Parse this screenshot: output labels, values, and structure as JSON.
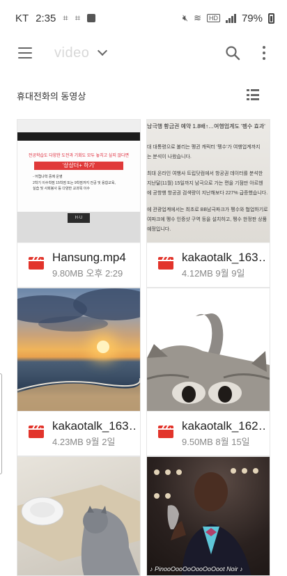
{
  "status_bar": {
    "carrier": "KT",
    "time": "2:35",
    "hd_badge": "HD",
    "battery_percent": "79%"
  },
  "toolbar": {
    "title": "video",
    "icons": [
      "menu-icon",
      "chevron-down-icon",
      "search-icon",
      "more-vert-icon"
    ]
  },
  "section": {
    "label": "휴대전화의 동영상",
    "view_toggle_icon": "list-view-icon"
  },
  "videos": [
    {
      "name": "Hansung.mp4",
      "meta": "9.80MB 오후 2:29",
      "slide": {
        "headline": "전공학습도 다양한 도전과 기회도 모두 놓치고 싶지 않다면",
        "banner": "'상상더+ 하기'",
        "bullets": [
          "- 어렵냐학 중에 운영",
          "2학기 이수학점 15학점 또는 9학점까지 전공 및 융합교육,",
          "실습 및 사회봉사 등 다양한 교과목 이수"
        ],
        "logo": "H·U"
      }
    },
    {
      "name": "kakaotalk_163…",
      "meta": "4.12MB 9월 9일",
      "doc": {
        "headline": "남극행 황금권 예약 1.8배↑…여행업계도 '펭수 효과'",
        "lines": [
          "대 대통령으로 불리는 펭귄 캐릭터 '펭수'가 여행업계까지",
          "는 분석이 나왔습니다.",
          "최대 온라인 여행사 트립닷컴에서 항공권 데이터를 분석한",
          "지난달(11월) 15일까지 남극으로 가는 편을 기점만 아르헨",
          "에 공항행 항공권 검색량이 지난해보다 227% 급증했습니다.",
          "에 관광업계에서는 최초로 BB남극파크가 펭수와 협업하기로",
          "여파크에 펭수 인증샷 구역 등을 설치하고, 펭수 한정판 상품",
          "예정입니다."
        ]
      }
    },
    {
      "name": "kakaotalk_163…",
      "meta": "4.23MB 9월 2일"
    },
    {
      "name": "kakaotalk_162…",
      "meta": "9.50MB 8월 15일"
    },
    {
      "name": "",
      "meta": ""
    },
    {
      "name": "",
      "meta": "",
      "caption": "♪ PinooOooOoOooOoOoot Noir ♪"
    }
  ],
  "colors": {
    "video_icon": "#e2342b",
    "background": "#ffffff",
    "muted_text": "#888888"
  }
}
